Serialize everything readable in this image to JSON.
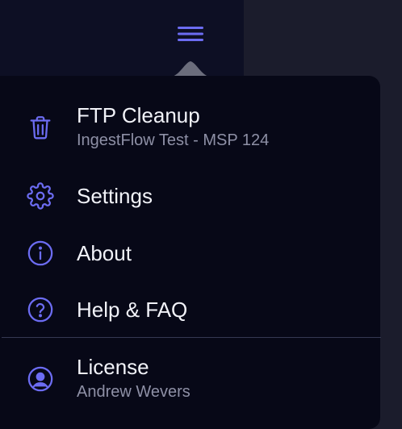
{
  "colors": {
    "accent": "#5b5cf0",
    "icon": "#6c6cf2",
    "label": "#f1f2f8",
    "sublabel": "#8e90a6",
    "dropdown_bg": "#070817",
    "sidebar_bg": "#0d0f24"
  },
  "header": {
    "menu_icon": "hamburger-menu-icon"
  },
  "menu": {
    "items": [
      {
        "icon": "trash-icon",
        "label": "FTP Cleanup",
        "sublabel": "IngestFlow Test - MSP 124"
      },
      {
        "icon": "gear-icon",
        "label": "Settings"
      },
      {
        "icon": "info-icon",
        "label": "About"
      },
      {
        "icon": "help-circle-icon",
        "label": "Help & FAQ"
      },
      {
        "icon": "user-circle-icon",
        "label": "License",
        "sublabel": "Andrew Wevers"
      }
    ]
  }
}
